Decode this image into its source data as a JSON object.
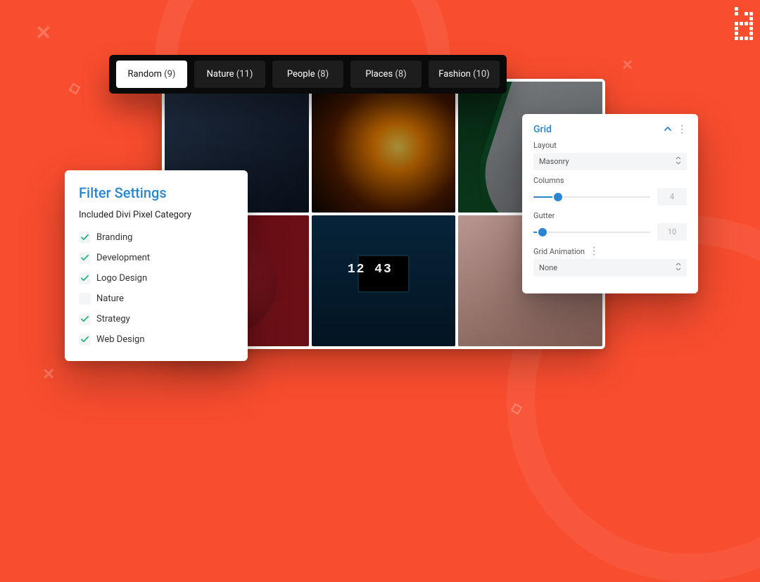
{
  "filterbar": {
    "tabs": [
      {
        "label": "Random",
        "count": "(9)",
        "active": true
      },
      {
        "label": "Nature",
        "count": "(11)",
        "active": false
      },
      {
        "label": "People",
        "count": "(8)",
        "active": false
      },
      {
        "label": "Places",
        "count": "(8)",
        "active": false
      },
      {
        "label": "Fashion",
        "count": "(10)",
        "active": false
      }
    ]
  },
  "filter_settings": {
    "title": "Filter Settings",
    "subtitle": "Included Divi Pixel Category",
    "items": [
      {
        "label": "Branding",
        "checked": true
      },
      {
        "label": "Development",
        "checked": true
      },
      {
        "label": "Logo Design",
        "checked": true
      },
      {
        "label": "Nature",
        "checked": false
      },
      {
        "label": "Strategy",
        "checked": true
      },
      {
        "label": "Web Design",
        "checked": true
      }
    ]
  },
  "grid_panel": {
    "title": "Grid",
    "layout_label": "Layout",
    "layout_value": "Masonry",
    "columns_label": "Columns",
    "columns_value": "4",
    "columns_percent": 21,
    "gutter_label": "Gutter",
    "gutter_value": "10",
    "gutter_percent": 8,
    "anim_label": "Grid Animation",
    "anim_value": "None"
  },
  "desk_clock": "12 43",
  "icons": {
    "caret_updown": "⇵",
    "chevron_up": "^",
    "kebab": "⋮"
  }
}
